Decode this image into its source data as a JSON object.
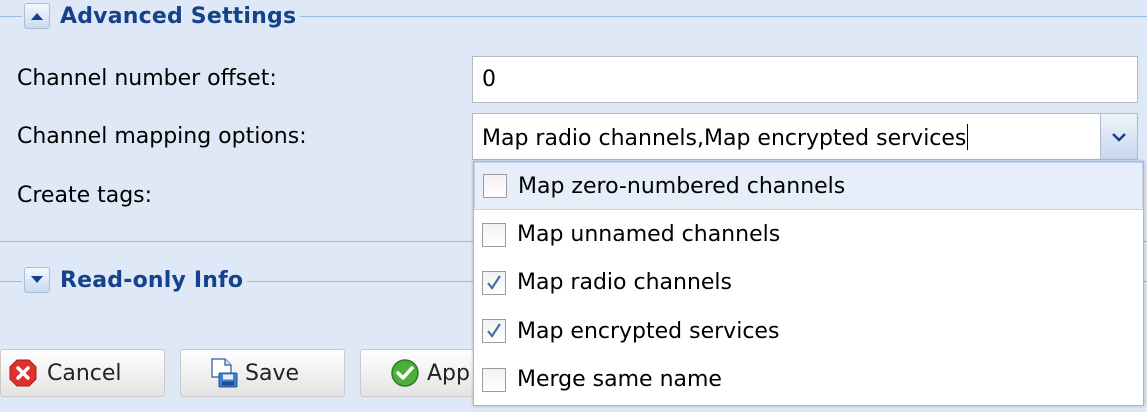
{
  "advanced": {
    "title": "Advanced Settings",
    "fields": {
      "offset_label": "Channel number offset:",
      "offset_value": "0",
      "mapping_label": "Channel mapping options:",
      "mapping_value": "Map radio channels,Map encrypted services",
      "tags_label": "Create tags:"
    }
  },
  "readonly": {
    "title": "Read-only Info"
  },
  "buttons": {
    "cancel": "Cancel",
    "save": "Save",
    "apply": "App"
  },
  "dropdown": {
    "items": [
      {
        "label": "Map zero-numbered channels",
        "checked": false
      },
      {
        "label": "Map unnamed channels",
        "checked": false
      },
      {
        "label": "Map radio channels",
        "checked": true
      },
      {
        "label": "Map encrypted services",
        "checked": true
      },
      {
        "label": "Merge same name",
        "checked": false
      }
    ]
  },
  "colors": {
    "background": "#dfe8f6",
    "legend": "#15428b",
    "check": "#4a6fa5"
  }
}
